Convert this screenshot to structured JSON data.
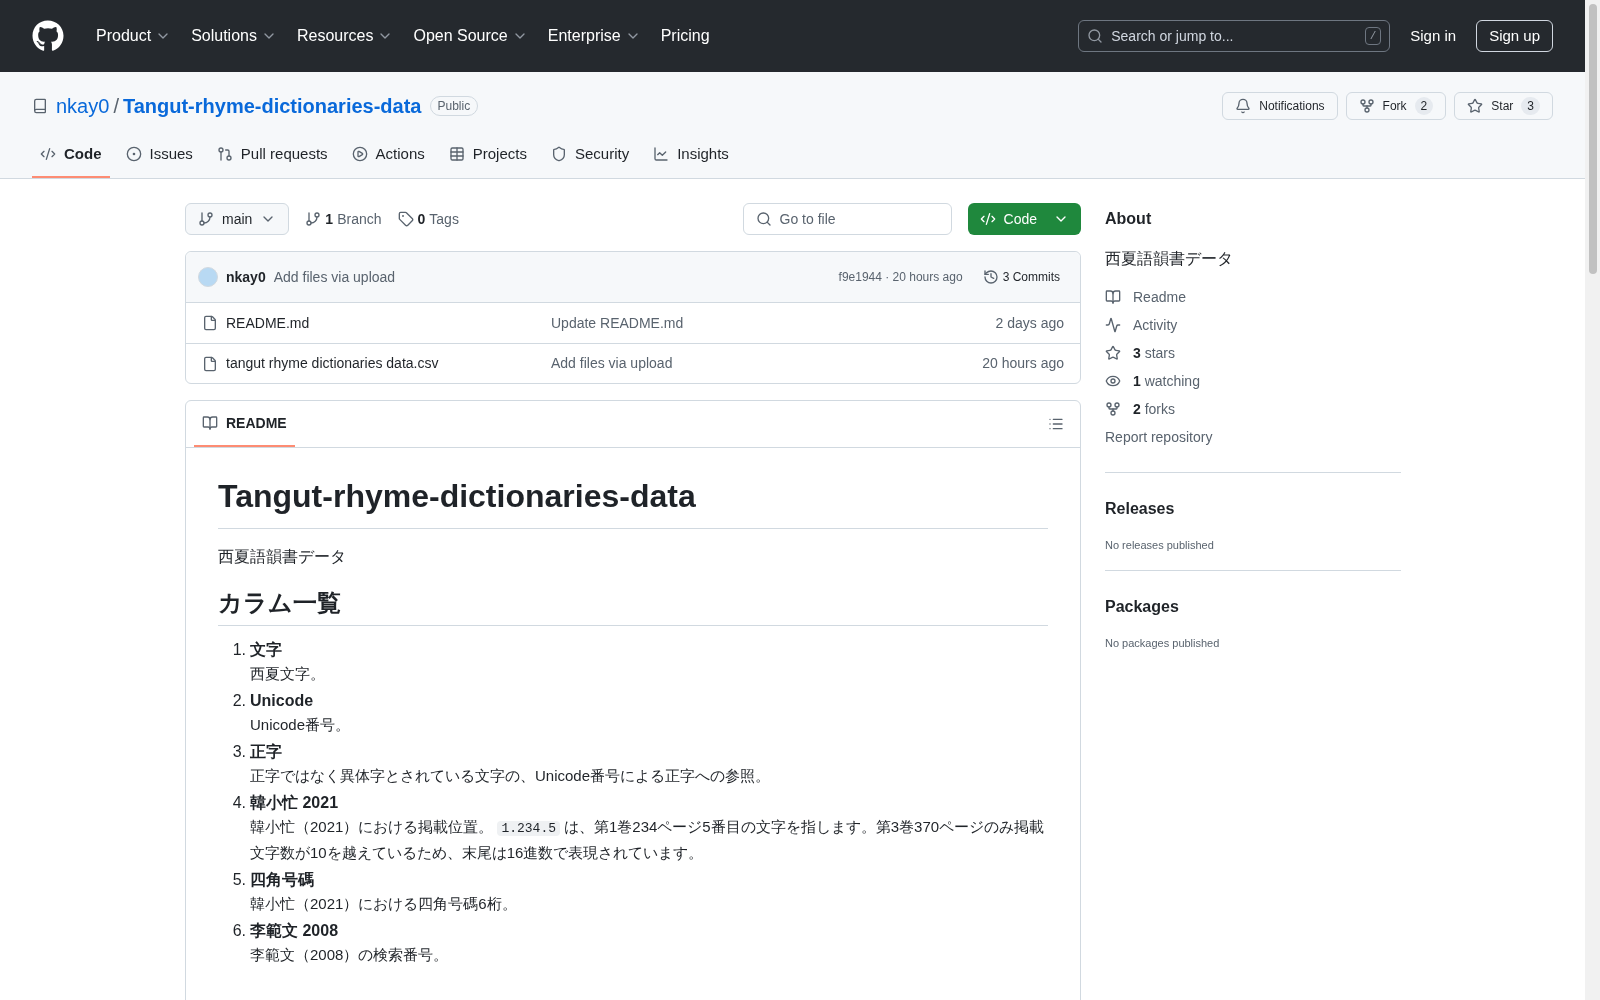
{
  "header": {
    "nav": [
      {
        "label": "Product",
        "dropdown": true
      },
      {
        "label": "Solutions",
        "dropdown": true
      },
      {
        "label": "Resources",
        "dropdown": true
      },
      {
        "label": "Open Source",
        "dropdown": true
      },
      {
        "label": "Enterprise",
        "dropdown": true
      },
      {
        "label": "Pricing",
        "dropdown": false
      }
    ],
    "search": {
      "placeholder": "Search or jump to...",
      "shortcut": "/"
    },
    "sign_in": "Sign in",
    "sign_up": "Sign up"
  },
  "repo": {
    "owner": "nkay0",
    "separator": "/",
    "name": "Tangut-rhyme-dictionaries-data",
    "visibility": "Public",
    "actions": [
      {
        "label": "Notifications"
      },
      {
        "label": "Fork",
        "count": "2"
      },
      {
        "label": "Star",
        "count": "3"
      }
    ]
  },
  "tabs": [
    {
      "label": "Code",
      "selected": true
    },
    {
      "label": "Issues",
      "selected": false
    },
    {
      "label": "Pull requests",
      "selected": false
    },
    {
      "label": "Actions",
      "selected": false
    },
    {
      "label": "Projects",
      "selected": false
    },
    {
      "label": "Security",
      "selected": false
    },
    {
      "label": "Insights",
      "selected": false
    }
  ],
  "toolbar": {
    "branch": "main",
    "branches_count": "1",
    "branches_label": "Branch",
    "tags_count": "0",
    "tags_label": "Tags",
    "go_to_file": {
      "placeholder": "Go to file"
    },
    "code_button": "Code"
  },
  "commit": {
    "author": "nkay0",
    "message": "Add files via upload",
    "hash_time": "f9e1944 · 20 hours ago",
    "commits": "3 Commits"
  },
  "files": [
    {
      "name": "README.md",
      "message": "Update README.md",
      "time": "2 days ago"
    },
    {
      "name": "tangut rhyme dictionaries data.csv",
      "message": "Add files via upload",
      "time": "20 hours ago"
    }
  ],
  "readme": {
    "tab": "README",
    "title": "Tangut-rhyme-dictionaries-data",
    "intro": "西夏語韻書データ",
    "section": "カラム一覧",
    "columns": [
      {
        "number": "1.",
        "name": "文字",
        "description": [
          {
            "kind": "text",
            "text": "西夏文字。"
          }
        ]
      },
      {
        "number": "2.",
        "name": "Unicode",
        "description": [
          {
            "kind": "text",
            "text": "Unicode番号。"
          }
        ]
      },
      {
        "number": "3.",
        "name": "正字",
        "description": [
          {
            "kind": "text",
            "text": "正字ではなく異体字とされている文字の、Unicode番号による正字への参照。"
          }
        ]
      },
      {
        "number": "4.",
        "name": "韓小忙 2021",
        "description": [
          {
            "kind": "text",
            "text": "韓小忙（2021）における掲載位置。"
          },
          {
            "kind": "code",
            "text": "1.234.5"
          },
          {
            "kind": "text",
            "text": "は、第1巻234ページ5番目の文字を指します。第3巻370ページのみ掲載文字数が10を越えているため、末尾は16進数で表現されています。"
          }
        ]
      },
      {
        "number": "5.",
        "name": "四角号碼",
        "description": [
          {
            "kind": "text",
            "text": "韓小忙（2021）における四角号碼6桁。"
          }
        ]
      },
      {
        "number": "6.",
        "name": "李範文 2008",
        "description": [
          {
            "kind": "text",
            "text": "李範文（2008）の検索番号。"
          }
        ]
      }
    ]
  },
  "about": {
    "title": "About",
    "description": "西夏語韻書データ",
    "links": [
      {
        "kind": "readme",
        "label": "Readme"
      },
      {
        "kind": "activity",
        "label": "Activity"
      },
      {
        "kind": "stars",
        "count": "3",
        "label": "stars"
      },
      {
        "kind": "watching",
        "count": "1",
        "label": "watching"
      },
      {
        "kind": "forks",
        "count": "2",
        "label": "forks"
      }
    ],
    "report": "Report repository"
  },
  "releases": {
    "title": "Releases",
    "note": "No releases published"
  },
  "packages": {
    "title": "Packages",
    "note": "No packages published"
  }
}
